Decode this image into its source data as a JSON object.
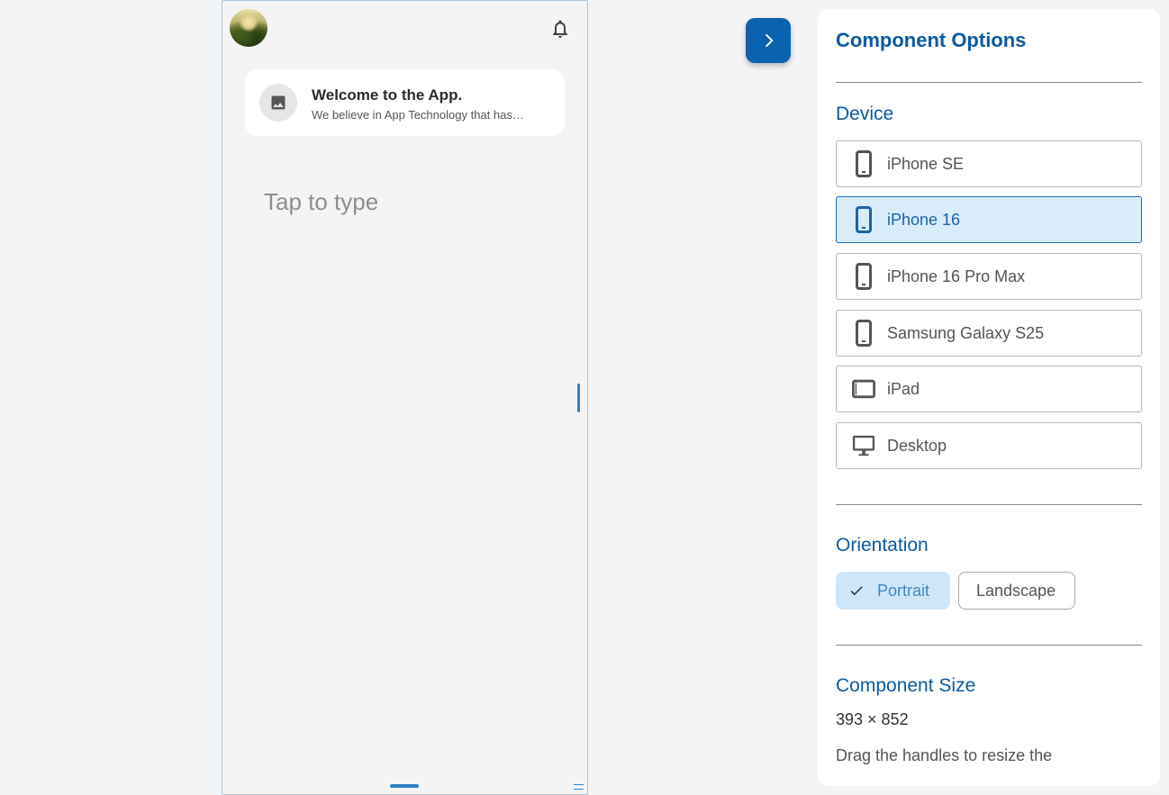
{
  "preview": {
    "welcome_title": "Welcome to the App.",
    "welcome_subtitle": "We believe in App Technology that has…",
    "input_placeholder": "Tap to type",
    "avatar_icon": "profile-photo",
    "bell_icon": "notifications-bell",
    "card_icon": "image-placeholder"
  },
  "panel": {
    "title": "Component Options",
    "device_section_title": "Device",
    "devices": [
      {
        "label": "iPhone SE",
        "icon": "phone-icon",
        "selected": false
      },
      {
        "label": "iPhone 16",
        "icon": "phone-icon",
        "selected": true
      },
      {
        "label": "iPhone 16 Pro Max",
        "icon": "phone-icon",
        "selected": false
      },
      {
        "label": "Samsung Galaxy S25",
        "icon": "phone-icon",
        "selected": false
      },
      {
        "label": "iPad",
        "icon": "tablet-icon",
        "selected": false
      },
      {
        "label": "Desktop",
        "icon": "desktop-icon",
        "selected": false
      }
    ],
    "orientation_section_title": "Orientation",
    "orientation_options": [
      {
        "label": "Portrait",
        "selected": true
      },
      {
        "label": "Landscape",
        "selected": false
      }
    ],
    "size_section_title": "Component Size",
    "size_value": "393 × 852",
    "size_hint": "Drag the handles to resize the"
  },
  "colors": {
    "accent": "#0b5aa0",
    "accent_button": "#0b63b0",
    "selected_bg": "#d9ecfa",
    "handle": "#2f80c8",
    "background": "#f3f4f6"
  }
}
